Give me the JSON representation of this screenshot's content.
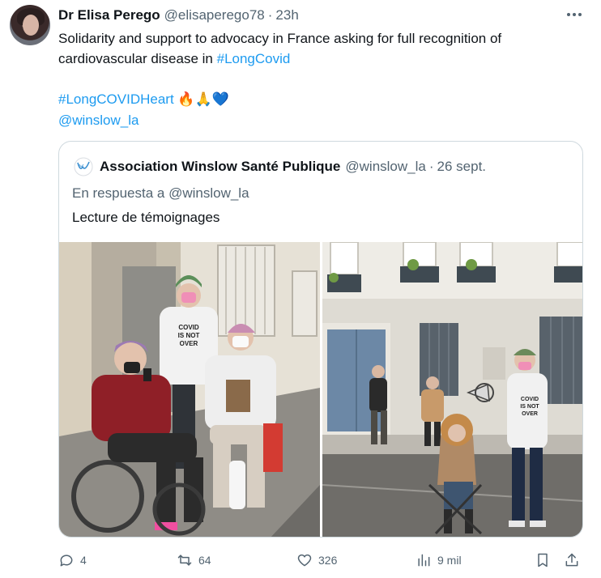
{
  "author": {
    "name": "Dr Elisa Perego",
    "handle": "@elisaperego78",
    "separator": "·",
    "time": "23h"
  },
  "tweet": {
    "line1": "Solidarity and support to advocacy in France asking for full recognition of",
    "line2_text": "cardiovascular disease in ",
    "line2_hashtag": "#LongCovid",
    "hashtag2": "#LongCOVIDHeart",
    "emoji_fire": "🔥",
    "emoji_pray": "🙏",
    "emoji_heart": "💙",
    "mention": "@winslow_la"
  },
  "quoted": {
    "name": "Association Winslow Santé Publique",
    "handle": "@winslow_la",
    "separator": "·",
    "date": "26 sept.",
    "reply_to": "En respuesta a @winslow_la",
    "text": "Lecture de témoignages",
    "photo_1_shirt_text": "COVID IS NOT OVER",
    "photo_2_shirt_text": "COVID IS NOT OVER"
  },
  "actions": {
    "replies": "4",
    "retweets": "64",
    "likes": "326",
    "views": "9 mil"
  },
  "colors": {
    "link": "#1d9bf0",
    "secondary_text": "#536471",
    "border": "#cfd9de"
  },
  "icons": [
    "more-icon",
    "winslow-logo-icon",
    "reply-icon",
    "retweet-icon",
    "like-icon",
    "views-icon",
    "bookmark-icon",
    "share-icon"
  ]
}
